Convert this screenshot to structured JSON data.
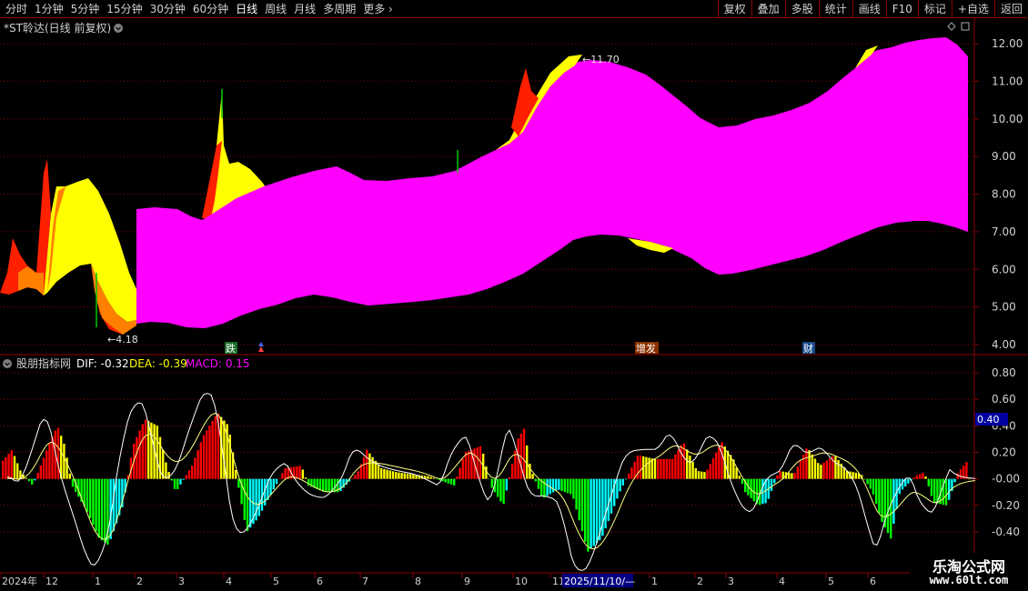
{
  "toolbar": {
    "periods": [
      "分时",
      "1分钟",
      "5分钟",
      "15分钟",
      "30分钟",
      "60分钟",
      "日线",
      "周线",
      "月线",
      "多周期"
    ],
    "active_period": "日线",
    "more": "更多",
    "more_arrow": "›",
    "buttons": [
      "复权",
      "叠加",
      "多股",
      "统计",
      "画线",
      "F10",
      "标记",
      "+自选",
      "返回"
    ]
  },
  "main_chart": {
    "title": "*ST聆达(日线 前复权)",
    "y_ticks": [
      "12.00",
      "11.00",
      "10.00",
      "9.00",
      "8.00",
      "7.00",
      "6.00",
      "5.00",
      "4.00"
    ],
    "y_values": [
      12,
      11,
      10,
      9,
      8,
      7,
      6,
      5,
      4
    ],
    "high_label": "11.70",
    "low_label": "4.18",
    "markers": [
      {
        "text": "跌",
        "bg": "#1a6e2a",
        "color": "#ffffff"
      },
      {
        "text": "增发",
        "bg": "#8a3000",
        "color": "#ffffff"
      },
      {
        "text": "财",
        "bg": "#164a8a",
        "color": "#ffffff"
      }
    ],
    "colors": {
      "band": "#ff00ff",
      "yellow": "#ffff00",
      "orange": "#ff8000",
      "red": "#ff2000",
      "green": "#00c800"
    }
  },
  "indicator": {
    "name": "股朋指标网",
    "dif_label": "DIF: -0.32",
    "dea_label": "DEA: -0.39",
    "macd_label": "MACD: 0.15",
    "y_ticks": [
      "0.80",
      "0.60",
      "0.40",
      "0.20",
      "-0.00",
      "-0.20",
      "-0.40"
    ],
    "y_values": [
      0.8,
      0.6,
      0.4,
      0.2,
      0,
      -0.2,
      -0.4
    ],
    "current_value": "0.40",
    "colors": {
      "pos_red": "#ff0000",
      "pos_yellow": "#ffff00",
      "neg_green": "#00ff00",
      "neg_cyan": "#00ffff",
      "dif": "#ffffff",
      "dea": "#ffff80"
    }
  },
  "x_axis": {
    "labels": [
      "2024年",
      "12",
      "1",
      "2",
      "3",
      "4",
      "5",
      "6",
      "7",
      "8",
      "9",
      "10",
      "11",
      "2025/11/10/—",
      "1",
      "2",
      "3",
      "4",
      "5",
      "6"
    ],
    "highlight": "2025/11/10/—"
  },
  "watermark": {
    "line1": "乐淘公式网",
    "line2": "www.60lt.com"
  }
}
